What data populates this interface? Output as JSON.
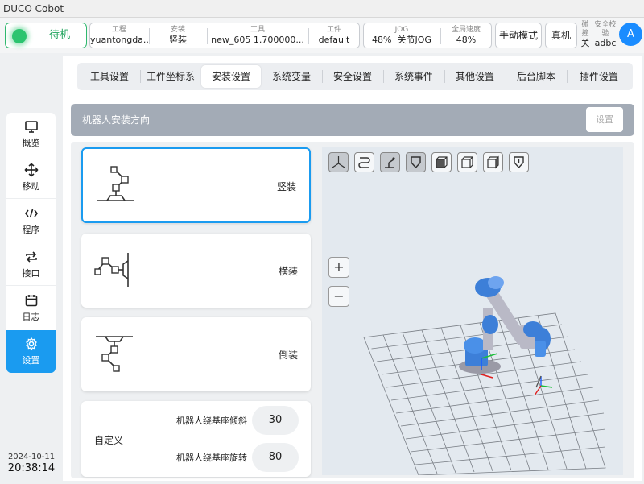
{
  "window": {
    "title": "DUCO Cobot"
  },
  "status": {
    "state": "待机",
    "project": {
      "caption": "工程",
      "value": "yuantongda..."
    },
    "install": {
      "caption": "安装",
      "value": "竖装"
    },
    "tool": {
      "caption": "工具",
      "value": "new_605   1.700000..."
    },
    "workpiece": {
      "caption": "工件",
      "value": "default"
    },
    "jog": {
      "caption": "JOG",
      "percent": "48%",
      "mode": "关节JOG"
    },
    "speed": {
      "caption": "全局速度",
      "value": "48%"
    },
    "manual_mode": "手动模式",
    "real_machine": "真机",
    "collision": {
      "caption": "碰撞",
      "value": "关"
    },
    "safety": {
      "caption": "安全校验",
      "value": "adbc"
    },
    "avatar": "A"
  },
  "sidebar": {
    "items": [
      {
        "label": "概览",
        "icon": "monitor-icon"
      },
      {
        "label": "移动",
        "icon": "move-icon"
      },
      {
        "label": "程序",
        "icon": "code-icon"
      },
      {
        "label": "接口",
        "icon": "swap-icon"
      },
      {
        "label": "日志",
        "icon": "calendar-icon"
      },
      {
        "label": "设置",
        "icon": "gear-icon"
      }
    ]
  },
  "datetime": {
    "date": "2024-10-11",
    "time": "20:38:14"
  },
  "tabs": [
    "工具设置",
    "工件坐标系",
    "安装设置",
    "系统变量",
    "安全设置",
    "系统事件",
    "其他设置",
    "后台脚本",
    "插件设置"
  ],
  "active_tab": "安装设置",
  "section": {
    "title": "机器人安装方向",
    "set_button": "设置"
  },
  "options": {
    "vertical": "竖装",
    "horizontal": "横装",
    "inverted": "倒装",
    "custom": "自定义"
  },
  "custom": {
    "tilt_label": "机器人绕基座倾斜",
    "tilt_value": "30",
    "rotate_label": "机器人绕基座旋转",
    "rotate_value": "80"
  },
  "viewport": {
    "zoom_in": "+",
    "zoom_out": "−",
    "accent": "#1a9bf0",
    "robot_color": "#3d7fd8"
  }
}
